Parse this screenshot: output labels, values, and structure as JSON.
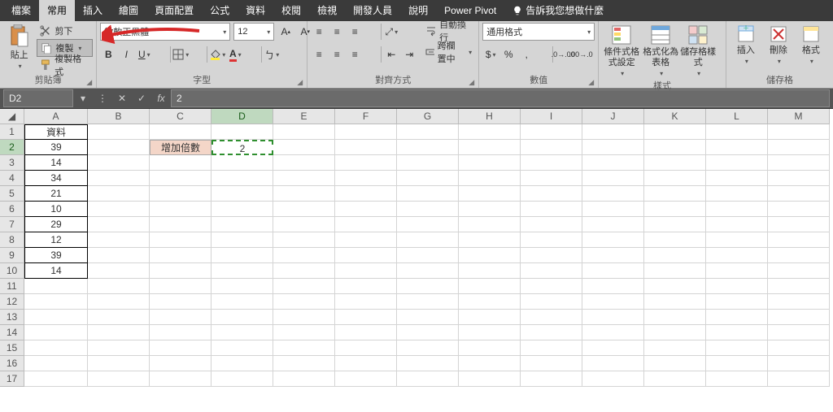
{
  "tabs": {
    "file": "檔案",
    "home": "常用",
    "insert": "插入",
    "draw": "繪圖",
    "pagelayout": "頁面配置",
    "formulas": "公式",
    "data": "資料",
    "review": "校閱",
    "view": "檢視",
    "developer": "開發人員",
    "help": "說明",
    "powerpivot": "Power Pivot",
    "tellme": "告訴我您想做什麼"
  },
  "clipboard": {
    "paste": "貼上",
    "cut": "剪下",
    "copy": "複製",
    "formatpainter": "複製格式",
    "label": "剪貼簿"
  },
  "font": {
    "family": "微軟正黑體",
    "size": "12",
    "label": "字型"
  },
  "alignment": {
    "wrap": "自動換行",
    "merge": "跨欄置中",
    "label": "對齊方式"
  },
  "number": {
    "format": "通用格式",
    "label": "數值"
  },
  "styles": {
    "cond": "條件式格式設定",
    "table": "格式化為表格",
    "cell": "儲存格樣式",
    "label": "樣式"
  },
  "cellsg": {
    "insert": "插入",
    "delete": "刪除",
    "format": "格式",
    "label": "儲存格"
  },
  "namebox": "D2",
  "formula": "2",
  "colA": "A",
  "colB": "B",
  "colC": "C",
  "colD": "D",
  "colE": "E",
  "colF": "F",
  "colG": "G",
  "colH": "H",
  "colI": "I",
  "colJ": "J",
  "colK": "K",
  "colL": "L",
  "colM": "M",
  "r1": "1",
  "r2": "2",
  "r3": "3",
  "r4": "4",
  "r5": "5",
  "r6": "6",
  "r7": "7",
  "r8": "8",
  "r9": "9",
  "r10": "10",
  "r11": "11",
  "r12": "12",
  "r13": "13",
  "r14": "14",
  "r15": "15",
  "r16": "16",
  "r17": "17",
  "sheet": {
    "head": "資料",
    "v1": "39",
    "v2": "14",
    "v3": "34",
    "v4": "21",
    "v5": "10",
    "v6": "29",
    "v7": "12",
    "v8": "39",
    "v9": "14"
  },
  "mult": {
    "label": "增加倍數",
    "value": "2"
  }
}
